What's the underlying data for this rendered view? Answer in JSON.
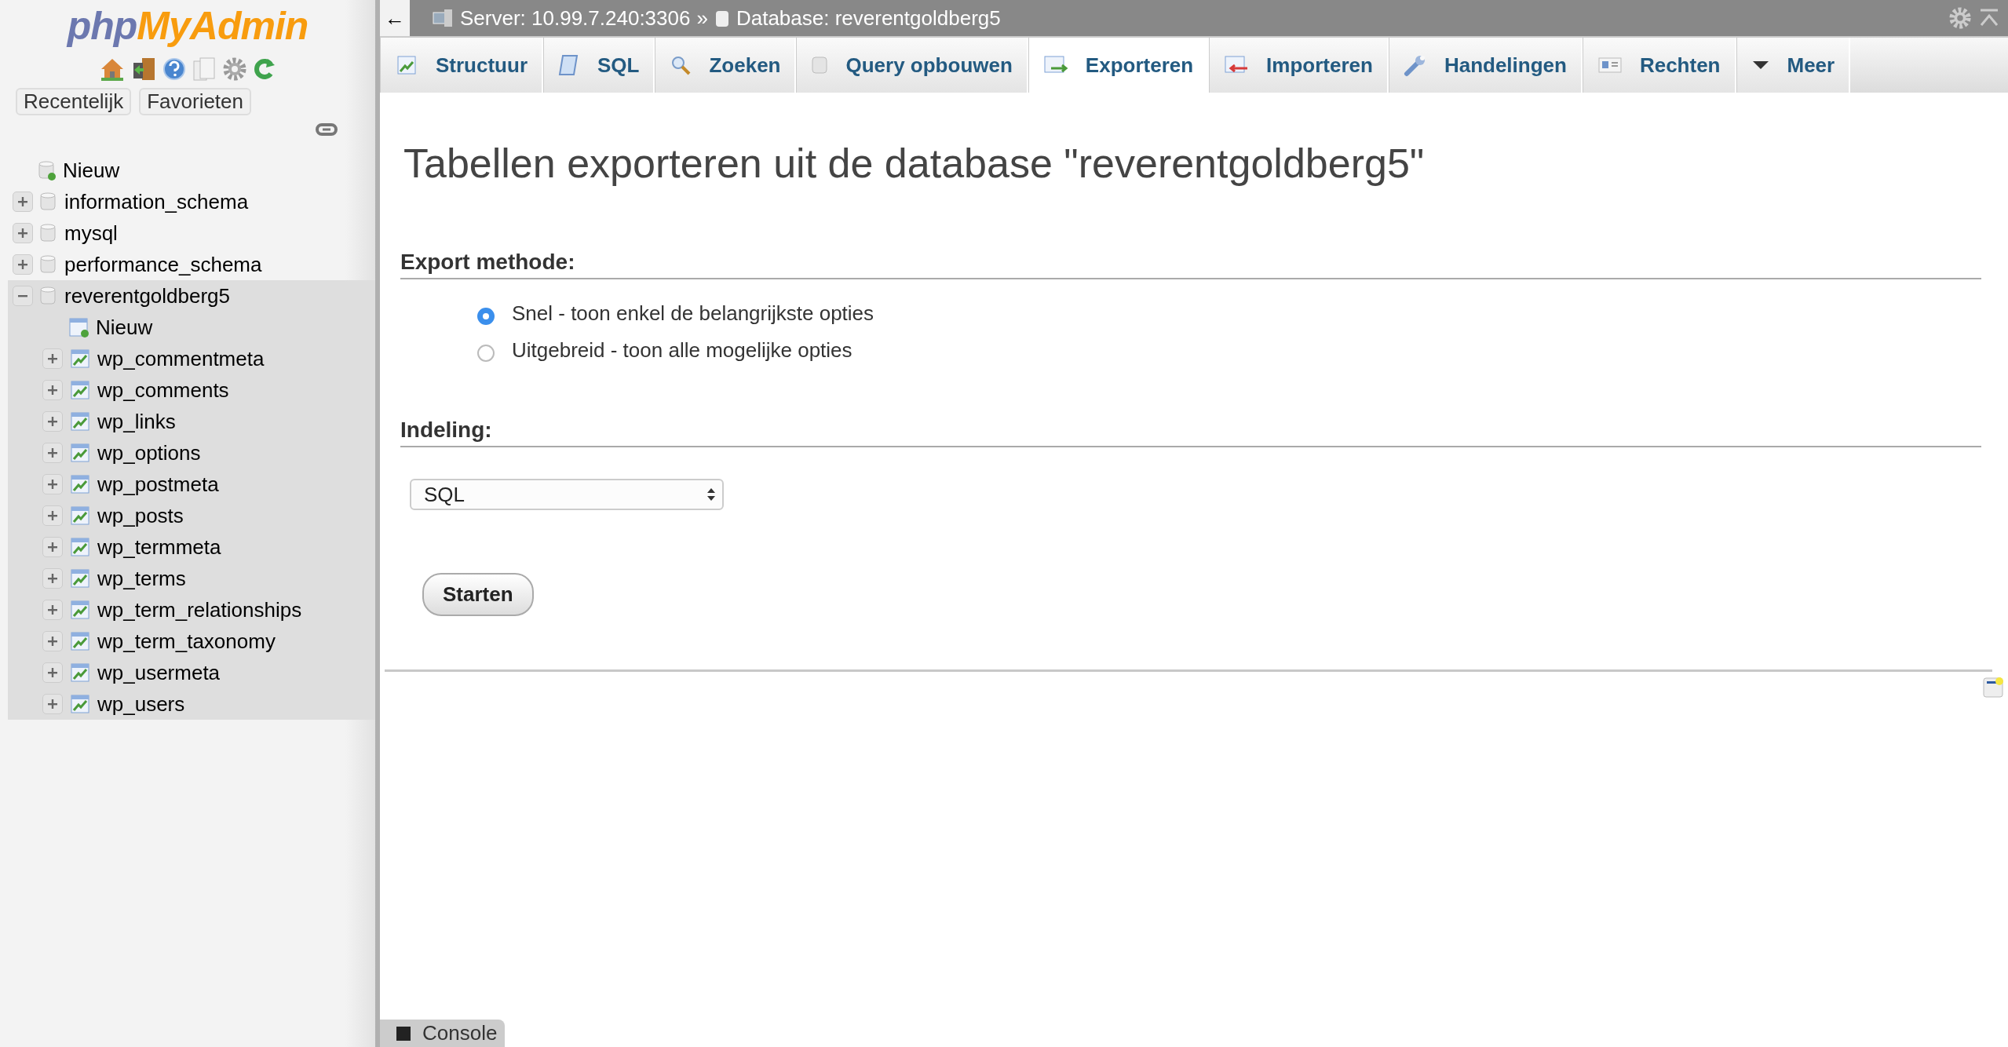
{
  "logo": {
    "part1": "php",
    "part2": "MyAdmin"
  },
  "sidebar": {
    "tabs": [
      {
        "label": "Recentelijk"
      },
      {
        "label": "Favorieten"
      }
    ],
    "tree": [
      {
        "label": "Nieuw",
        "kind": "new"
      },
      {
        "label": "information_schema",
        "kind": "db",
        "expanded": false,
        "selected": false
      },
      {
        "label": "mysql",
        "kind": "db",
        "expanded": false,
        "selected": false
      },
      {
        "label": "performance_schema",
        "kind": "db",
        "expanded": false,
        "selected": false
      },
      {
        "label": "reverentgoldberg5",
        "kind": "db",
        "expanded": true,
        "selected": true,
        "children": [
          {
            "label": "Nieuw",
            "kind": "new-table"
          },
          {
            "label": "wp_commentmeta",
            "kind": "table",
            "expanded": false
          },
          {
            "label": "wp_comments",
            "kind": "table",
            "expanded": false
          },
          {
            "label": "wp_links",
            "kind": "table",
            "expanded": false
          },
          {
            "label": "wp_options",
            "kind": "table",
            "expanded": false
          },
          {
            "label": "wp_postmeta",
            "kind": "table",
            "expanded": false
          },
          {
            "label": "wp_posts",
            "kind": "table",
            "expanded": false
          },
          {
            "label": "wp_termmeta",
            "kind": "table",
            "expanded": false
          },
          {
            "label": "wp_terms",
            "kind": "table",
            "expanded": false
          },
          {
            "label": "wp_term_relationships",
            "kind": "table",
            "expanded": false
          },
          {
            "label": "wp_term_taxonomy",
            "kind": "table",
            "expanded": false
          },
          {
            "label": "wp_usermeta",
            "kind": "table",
            "expanded": false
          },
          {
            "label": "wp_users",
            "kind": "table",
            "expanded": false
          }
        ]
      }
    ]
  },
  "topbar": {
    "back": "←",
    "server": "Server: 10.99.7.240:3306",
    "separator": "»",
    "database": "Database: reverentgoldberg5"
  },
  "tabs": [
    {
      "label": "Structuur",
      "kind": "structure",
      "selected": false
    },
    {
      "label": "SQL",
      "kind": "sql",
      "selected": false
    },
    {
      "label": "Zoeken",
      "kind": "search",
      "selected": false
    },
    {
      "label": "Query opbouwen",
      "kind": "query",
      "selected": false
    },
    {
      "label": "Exporteren",
      "kind": "export",
      "selected": true
    },
    {
      "label": "Importeren",
      "kind": "import",
      "selected": false
    },
    {
      "label": "Handelingen",
      "kind": "operations",
      "selected": false
    },
    {
      "label": "Rechten",
      "kind": "privileges",
      "selected": false
    },
    {
      "label": "Meer",
      "kind": "more",
      "selected": false
    }
  ],
  "heading": "Tabellen exporteren uit de database \"reverentgoldberg5\"",
  "export_method": {
    "title": "Export methode:",
    "options": [
      {
        "label": "Snel - toon enkel de belangrijkste opties",
        "selected": true
      },
      {
        "label": "Uitgebreid - toon alle mogelijke opties",
        "selected": false
      }
    ]
  },
  "format": {
    "title": "Indeling:",
    "value": "SQL"
  },
  "submit": "Starten",
  "console": "Console"
}
